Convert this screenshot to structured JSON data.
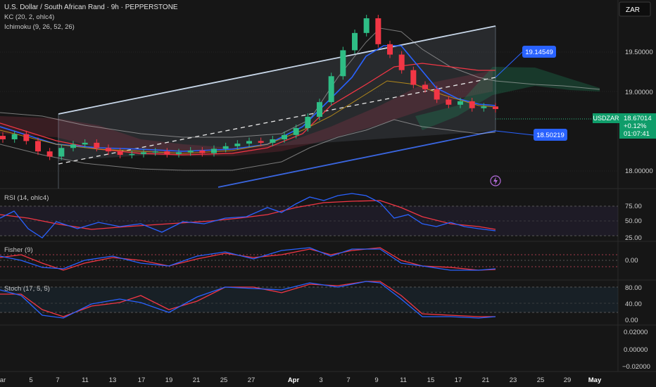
{
  "header": {
    "symbol_line": "U.S. Dollar / South African Rand · 9h · PEPPERSTONE",
    "kc_label": "KC (20, 2, ohlc4)",
    "ichimoku_label": "Ichimoku (9, 26, 52, 26)",
    "currency_button": "ZAR"
  },
  "price_panel": {
    "ticks": [
      "19.50000",
      "19.00000",
      "18.00000"
    ],
    "tag_upper": "19.14549",
    "tag_lower": "18.50219",
    "last_symbol": "USDZAR",
    "last_price": "18.67014",
    "last_change": "+0.12%",
    "countdown": "01:07:41"
  },
  "rsi_panel": {
    "label": "RSI (14, ohlc4)",
    "ticks": [
      "75.00",
      "50.00",
      "25.00"
    ]
  },
  "fisher_panel": {
    "label": "Fisher (9)",
    "ticks": [
      "0.00"
    ]
  },
  "stoch_panel": {
    "label": "Stoch (17, 5, 5)",
    "ticks": [
      "80.00",
      "40.00",
      "0.00"
    ]
  },
  "bottom_panel": {
    "ticks": [
      "0.02000",
      "0.00000",
      "−0.02000"
    ]
  },
  "time_axis": {
    "labels": [
      "ar",
      "5",
      "7",
      "11",
      "13",
      "17",
      "19",
      "21",
      "25",
      "27",
      "Apr",
      "3",
      "7",
      "9",
      "11",
      "15",
      "17",
      "21",
      "23",
      "25",
      "29",
      "May"
    ]
  },
  "colors": {
    "background": "#161616",
    "up_candle": "#2ebd85",
    "down_candle": "#f23645",
    "channel_line": "#b8cce4",
    "channel_lower": "#2962ff",
    "tag_blue": "#2962ff",
    "last_price_green": "#0f9d6a",
    "rsi_line": "#2962ff",
    "rsi_signal": "#f23645"
  },
  "chart_data": {
    "type": "line",
    "title": "U.S. Dollar / South African Rand · 9h · PEPPERSTONE",
    "series": [
      {
        "name": "USDZAR",
        "values": [
          18.32,
          18.38,
          18.3,
          18.18,
          18.12,
          18.22,
          18.26,
          18.28,
          18.22,
          18.18,
          18.14,
          18.15,
          18.17,
          18.18,
          18.15,
          18.17,
          18.19,
          18.16,
          18.21,
          18.24,
          18.27,
          18.3,
          18.28,
          18.32,
          18.37,
          18.45,
          18.58,
          18.75,
          19.05,
          19.35,
          19.55,
          19.72,
          19.42,
          19.3,
          19.12,
          18.95,
          18.9,
          18.78,
          18.72,
          18.76,
          18.68,
          18.7,
          18.67
        ]
      }
    ],
    "ylim": [
      17.75,
      19.85
    ],
    "ylabel": "",
    "xlabel": ""
  }
}
